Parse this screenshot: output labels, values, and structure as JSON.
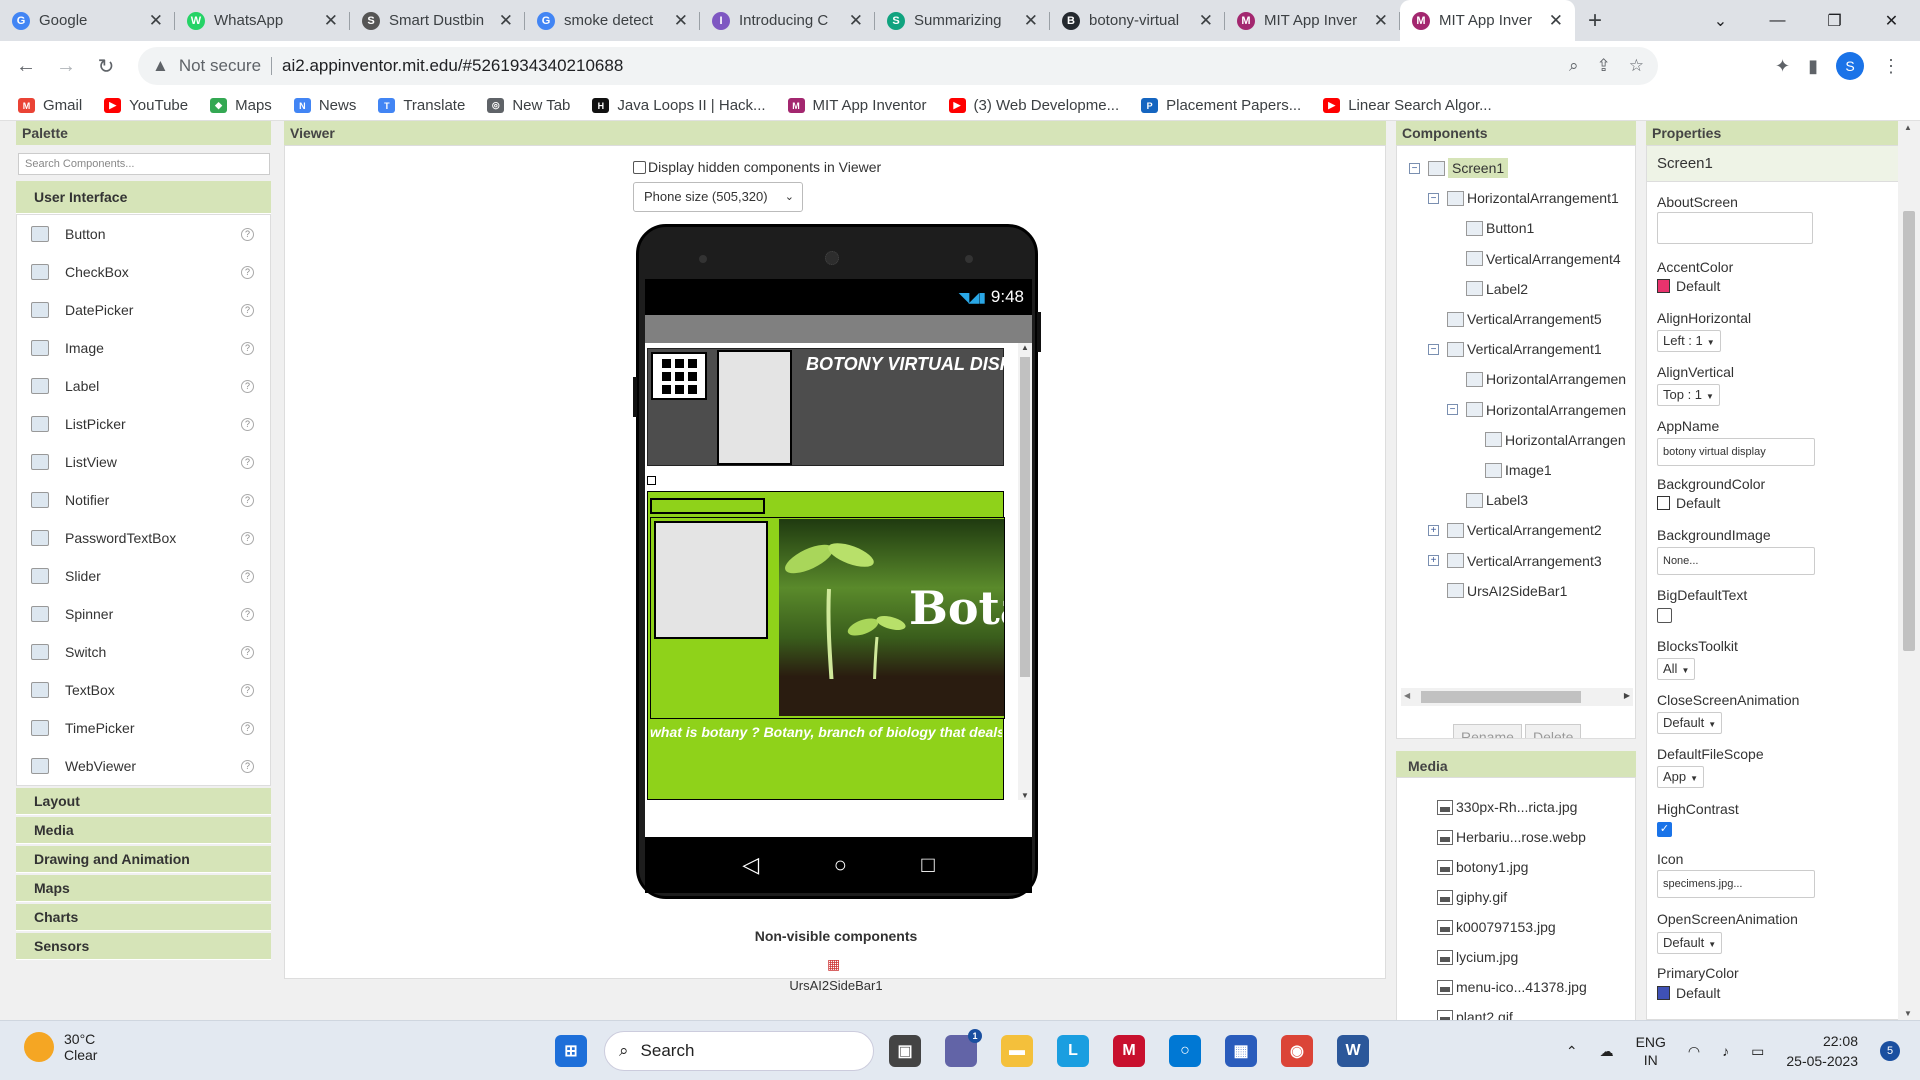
{
  "browser": {
    "tabs": [
      {
        "title": "Google",
        "color": "#4285f4",
        "glyph": "G"
      },
      {
        "title": "WhatsApp",
        "color": "#25d366",
        "glyph": "W"
      },
      {
        "title": "Smart Dustbin",
        "color": "#555555",
        "glyph": "S"
      },
      {
        "title": "smoke detect",
        "color": "#4285f4",
        "glyph": "G"
      },
      {
        "title": "Introducing C",
        "color": "#7e57c2",
        "glyph": "I"
      },
      {
        "title": "Summarizing",
        "color": "#10a37f",
        "glyph": "S"
      },
      {
        "title": "botony-virtual",
        "color": "#24292f",
        "glyph": "B"
      },
      {
        "title": "MIT App Inver",
        "color": "#a3276f",
        "glyph": "M"
      },
      {
        "title": "MIT App Inver",
        "color": "#a3276f",
        "glyph": "M"
      }
    ],
    "address": {
      "security_label": "Not secure",
      "url": "ai2.appinventor.mit.edu/#5261934340210688"
    },
    "profile_initial": "S",
    "bookmarks": [
      {
        "label": "Gmail",
        "color": "#ea4335",
        "glyph": "M"
      },
      {
        "label": "YouTube",
        "color": "#ff0000",
        "glyph": "▶"
      },
      {
        "label": "Maps",
        "color": "#34a853",
        "glyph": "◆"
      },
      {
        "label": "News",
        "color": "#4285f4",
        "glyph": "N"
      },
      {
        "label": "Translate",
        "color": "#4285f4",
        "glyph": "T"
      },
      {
        "label": "New Tab",
        "color": "#5f6368",
        "glyph": "◎"
      },
      {
        "label": "Java Loops II | Hack...",
        "color": "#111111",
        "glyph": "H"
      },
      {
        "label": "MIT App Inventor",
        "color": "#a3276f",
        "glyph": "M"
      },
      {
        "label": "(3) Web Developme...",
        "color": "#ff0000",
        "glyph": "▶"
      },
      {
        "label": "Placement Papers...",
        "color": "#1565c0",
        "glyph": "P"
      },
      {
        "label": "Linear Search Algor...",
        "color": "#ff0000",
        "glyph": "▶"
      }
    ]
  },
  "palette": {
    "header": "Palette",
    "search_placeholder": "Search Components...",
    "category_open": "User Interface",
    "items": [
      {
        "label": "Button",
        "icon": "button-icon"
      },
      {
        "label": "CheckBox",
        "icon": "checkbox-icon"
      },
      {
        "label": "DatePicker",
        "icon": "datepicker-icon"
      },
      {
        "label": "Image",
        "icon": "image-icon"
      },
      {
        "label": "Label",
        "icon": "label-icon"
      },
      {
        "label": "ListPicker",
        "icon": "listpicker-icon"
      },
      {
        "label": "ListView",
        "icon": "listview-icon"
      },
      {
        "label": "Notifier",
        "icon": "notifier-icon"
      },
      {
        "label": "PasswordTextBox",
        "icon": "password-icon"
      },
      {
        "label": "Slider",
        "icon": "slider-icon"
      },
      {
        "label": "Spinner",
        "icon": "spinner-icon"
      },
      {
        "label": "Switch",
        "icon": "switch-icon"
      },
      {
        "label": "TextBox",
        "icon": "textbox-icon"
      },
      {
        "label": "TimePicker",
        "icon": "timepicker-icon"
      },
      {
        "label": "WebViewer",
        "icon": "webviewer-icon"
      }
    ],
    "categories_closed": [
      "Layout",
      "Media",
      "Drawing and Animation",
      "Maps",
      "Charts",
      "Sensors"
    ]
  },
  "viewer": {
    "header": "Viewer",
    "hidden_components_label": "Display hidden components in Viewer",
    "phone_size": "Phone size (505,320)",
    "status_time": "9:48",
    "app_title": "BOTONY VIRTUAL DISPLAY",
    "image_text": "Botany",
    "label3_text": "what is botany ? Botany, branch of biology that deals with plant life",
    "nonvisible_header": "Non-visible components",
    "nonvisible_item": "UrsAI2SideBar1"
  },
  "components": {
    "header": "Components",
    "tree": [
      {
        "label": "Screen1",
        "toggle": "−",
        "depth": 0,
        "selected": true
      },
      {
        "label": "HorizontalArrangement1",
        "toggle": "−",
        "depth": 1
      },
      {
        "label": "Button1",
        "toggle": "",
        "depth": 2
      },
      {
        "label": "VerticalArrangement4",
        "toggle": "",
        "depth": 2
      },
      {
        "label": "Label2",
        "toggle": "",
        "depth": 2
      },
      {
        "label": "VerticalArrangement5",
        "toggle": "",
        "depth": 1
      },
      {
        "label": "VerticalArrangement1",
        "toggle": "−",
        "depth": 1
      },
      {
        "label": "HorizontalArrangemen",
        "toggle": "",
        "depth": 2
      },
      {
        "label": "HorizontalArrangemen",
        "toggle": "−",
        "depth": 2
      },
      {
        "label": "HorizontalArrangen",
        "toggle": "",
        "depth": 3
      },
      {
        "label": "Image1",
        "toggle": "",
        "depth": 3
      },
      {
        "label": "Label3",
        "toggle": "",
        "depth": 2
      },
      {
        "label": "VerticalArrangement2",
        "toggle": "+",
        "depth": 1
      },
      {
        "label": "VerticalArrangement3",
        "toggle": "+",
        "depth": 1
      },
      {
        "label": "UrsAI2SideBar1",
        "toggle": "",
        "depth": 1
      }
    ],
    "rename_label": "Rename",
    "delete_label": "Delete"
  },
  "media": {
    "header": "Media",
    "files": [
      "330px-Rh...ricta.jpg",
      "Herbariu...rose.webp",
      "botony1.jpg",
      "giphy.gif",
      "k000797153.jpg",
      "lycium.jpg",
      "menu-ico...41378.jpg",
      "plant2.gif"
    ]
  },
  "properties": {
    "header": "Properties",
    "screen": "Screen1",
    "about_screen_label": "AboutScreen",
    "accent_color_label": "AccentColor",
    "accent_color_value": "Default",
    "accent_color": "#e8336d",
    "align_h_label": "AlignHorizontal",
    "align_h_value": "Left : 1",
    "align_v_label": "AlignVertical",
    "align_v_value": "Top : 1",
    "app_name_label": "AppName",
    "app_name_value": "botony virtual display",
    "bg_color_label": "BackgroundColor",
    "bg_color_value": "Default",
    "bg_image_label": "BackgroundImage",
    "bg_image_value": "None...",
    "big_text_label": "BigDefaultText",
    "blocks_toolkit_label": "BlocksToolkit",
    "blocks_toolkit_value": "All",
    "close_anim_label": "CloseScreenAnimation",
    "close_anim_value": "Default",
    "file_scope_label": "DefaultFileScope",
    "file_scope_value": "App",
    "high_contrast_label": "HighContrast",
    "icon_label": "Icon",
    "icon_value": "specimens.jpg...",
    "open_anim_label": "OpenScreenAnimation",
    "open_anim_value": "Default",
    "primary_color_label": "PrimaryColor",
    "primary_color_value": "Default",
    "primary_color": "#3f51b5"
  },
  "taskbar": {
    "temperature": "30°C",
    "condition": "Clear",
    "search_label": "Search",
    "lang_top": "ENG",
    "lang_bottom": "IN",
    "time": "22:08",
    "date": "25-05-2023",
    "notifications": "5",
    "chat_badge": "1"
  }
}
